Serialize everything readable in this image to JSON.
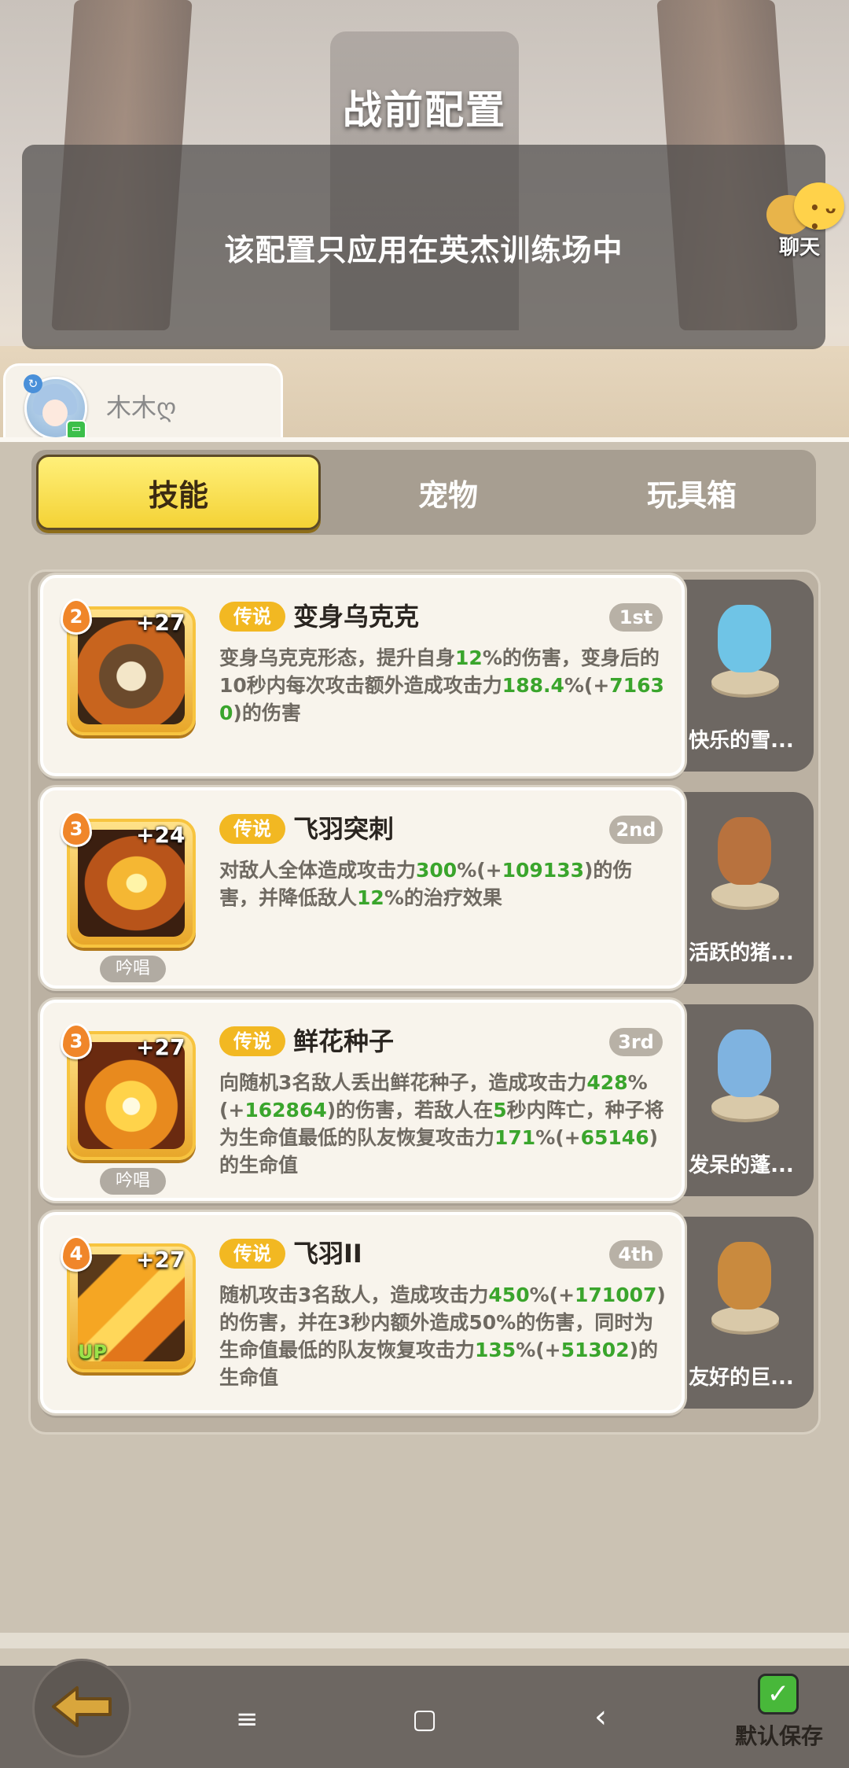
{
  "header": {
    "title": "战前配置",
    "notice": "该配置只应用在英杰训练场中",
    "chat_label": "聊天"
  },
  "user": {
    "name": "木木ღ"
  },
  "tabs": [
    {
      "label": "技能",
      "active": true
    },
    {
      "label": "宠物",
      "active": false
    },
    {
      "label": "玩具箱",
      "active": false
    }
  ],
  "skills": [
    {
      "level": "2",
      "plus": "+27",
      "rarity": "传说",
      "name": "变身乌克克",
      "rank": "1st",
      "desc": [
        {
          "t": "变身乌克克形态，提升自身"
        },
        {
          "t": "12",
          "g": true
        },
        {
          "t": "%的伤害，变身后的10秒内每次攻击额外造成攻击力"
        },
        {
          "t": "188.4",
          "g": true
        },
        {
          "t": "%(+"
        },
        {
          "t": "71630",
          "g": true
        },
        {
          "t": ")的伤害"
        }
      ],
      "chant": null,
      "up": null,
      "pet": {
        "name": "快乐的雪...",
        "color": "#6fc4e6"
      }
    },
    {
      "level": "3",
      "plus": "+24",
      "rarity": "传说",
      "name": "飞羽突刺",
      "rank": "2nd",
      "desc": [
        {
          "t": "对敌人全体造成攻击力"
        },
        {
          "t": "300",
          "g": true
        },
        {
          "t": "%(+"
        },
        {
          "t": "109133",
          "g": true
        },
        {
          "t": ")的伤害，并降低敌人"
        },
        {
          "t": "12",
          "g": true
        },
        {
          "t": "%的治疗效果"
        }
      ],
      "chant": "吟唱",
      "up": null,
      "pet": {
        "name": "活跃的猪...",
        "color": "#b8723e"
      }
    },
    {
      "level": "3",
      "plus": "+27",
      "rarity": "传说",
      "name": "鲜花种子",
      "rank": "3rd",
      "desc": [
        {
          "t": "向随机3名敌人丢出鲜花种子，造成攻击力"
        },
        {
          "t": "428",
          "g": true
        },
        {
          "t": "%(+"
        },
        {
          "t": "162864",
          "g": true
        },
        {
          "t": ")的伤害，若敌人在"
        },
        {
          "t": "5",
          "g": true
        },
        {
          "t": "秒内阵亡，种子将为生命值最低的队友恢复攻击力"
        },
        {
          "t": "171",
          "g": true
        },
        {
          "t": "%(+"
        },
        {
          "t": "65146",
          "g": true
        },
        {
          "t": ")的生命值"
        }
      ],
      "chant": "吟唱",
      "up": null,
      "pet": {
        "name": "发呆的蓬...",
        "color": "#7fb3e0"
      }
    },
    {
      "level": "4",
      "plus": "+27",
      "rarity": "传说",
      "name": "飞羽II",
      "rank": "4th",
      "desc": [
        {
          "t": "随机攻击3名敌人，造成攻击力"
        },
        {
          "t": "450",
          "g": true
        },
        {
          "t": "%(+"
        },
        {
          "t": "171007",
          "g": true
        },
        {
          "t": ")的伤害，并在3秒内额外造成50%的伤害，同时为生命值最低的队友恢复攻击力"
        },
        {
          "t": "135",
          "g": true
        },
        {
          "t": "%(+"
        },
        {
          "t": "51302",
          "g": true
        },
        {
          "t": ")的生命值"
        }
      ],
      "chant": null,
      "up": "UP",
      "pet": {
        "name": "友好的巨...",
        "color": "#c98a3e"
      }
    }
  ],
  "footer": {
    "save_label": "默认保存",
    "check_glyph": "✓"
  },
  "nav": {
    "menu": "≡",
    "home": "▢",
    "back": "‹"
  },
  "colors": {
    "accent": "#f4d235",
    "rarity": "#f2b822",
    "highlight": "#3aa52c"
  }
}
